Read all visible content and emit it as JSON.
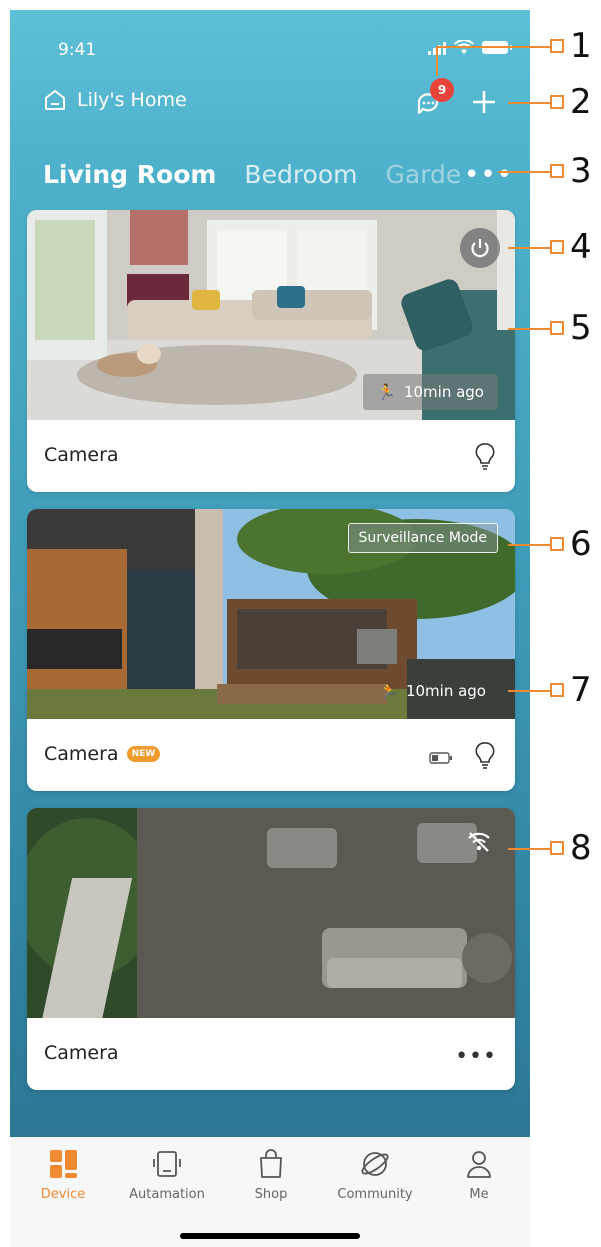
{
  "status": {
    "time": "9:41"
  },
  "header": {
    "home_name": "Lily's Home",
    "notification_count": "9"
  },
  "tabs": [
    {
      "label": "Living Room",
      "active": true
    },
    {
      "label": "Bedroom"
    },
    {
      "label": "Garde"
    }
  ],
  "cards": [
    {
      "name": "Camera",
      "event_time": "10min ago"
    },
    {
      "name": "Camera",
      "badge": "NEW",
      "mode": "Surveillance Mode",
      "event_time": "10min ago"
    },
    {
      "name": "Camera"
    }
  ],
  "nav": [
    {
      "label": "Device",
      "active": true
    },
    {
      "label": "Autamation"
    },
    {
      "label": "Shop"
    },
    {
      "label": "Community"
    },
    {
      "label": "Me"
    }
  ],
  "callouts": [
    "1",
    "2",
    "3",
    "4",
    "5",
    "6",
    "7",
    "8"
  ],
  "colors": {
    "accent": "#f08a30",
    "badge_red": "#e9443a",
    "new_badge": "#f19a2d"
  }
}
